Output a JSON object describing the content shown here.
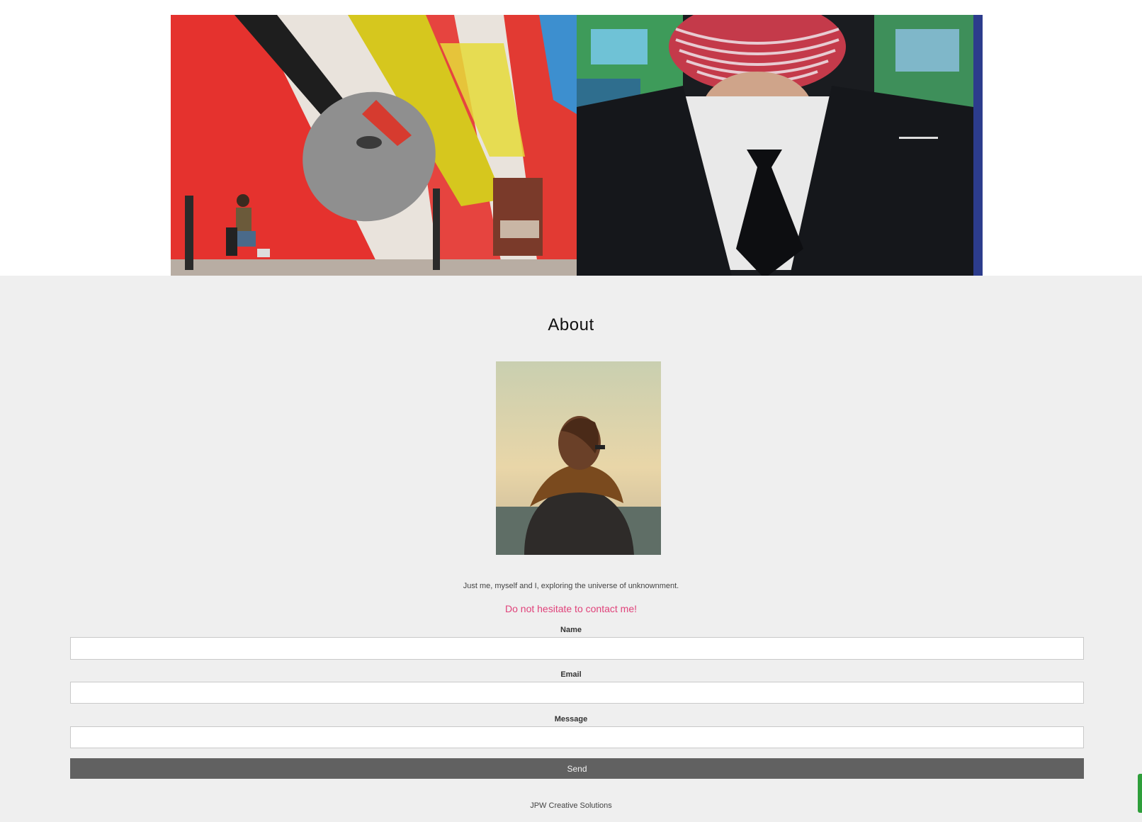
{
  "gallery": {
    "images": [
      {
        "alt": "Street mural of a face with red and yellow paint and a person kneeling"
      },
      {
        "alt": "Mural of a man in a black suit and tie with a striped hat"
      }
    ]
  },
  "about": {
    "title": "About",
    "portrait_alt": "Person with scarf facing the sea at sunset",
    "bio": "Just me, myself and I, exploring the universe of unknownment.",
    "cta": "Do not hesitate to contact me!"
  },
  "form": {
    "name_label": "Name",
    "email_label": "Email",
    "message_label": "Message",
    "name_value": "",
    "email_value": "",
    "message_value": "",
    "send_label": "Send"
  },
  "footer": {
    "text": "JPW Creative Solutions"
  },
  "colors": {
    "accent": "#e0427a",
    "button": "#616161",
    "section_bg": "#efefef"
  }
}
